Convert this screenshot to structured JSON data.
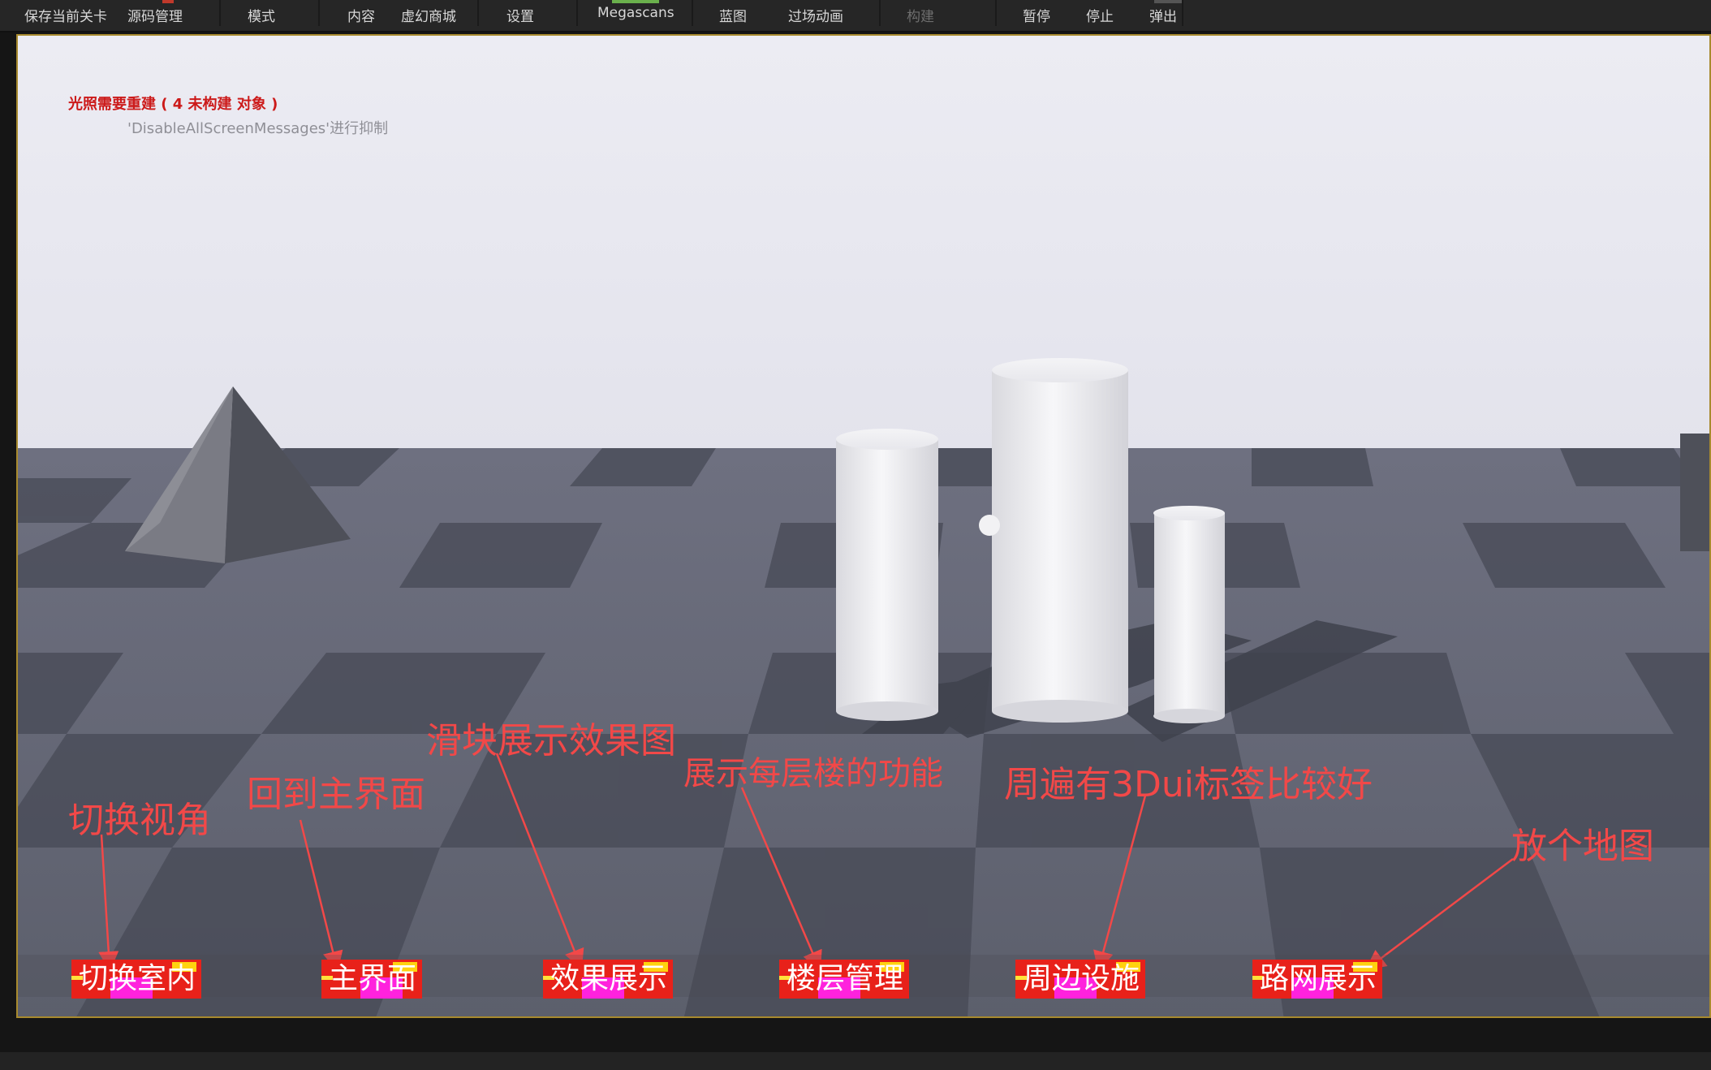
{
  "toolbar": {
    "items": [
      {
        "label": "保存当前关卡",
        "disabled": false
      },
      {
        "label": "源码管理",
        "disabled": false
      },
      {
        "label": "模式",
        "disabled": false
      },
      {
        "label": "内容",
        "disabled": false
      },
      {
        "label": "虚幻商城",
        "disabled": false
      },
      {
        "label": "设置",
        "disabled": false
      },
      {
        "label": "Megascans",
        "disabled": false
      },
      {
        "label": "蓝图",
        "disabled": false
      },
      {
        "label": "过场动画",
        "disabled": false
      },
      {
        "label": "构建",
        "disabled": true
      },
      {
        "label": "暂停",
        "disabled": false
      },
      {
        "label": "停止",
        "disabled": false
      },
      {
        "label": "弹出",
        "disabled": false
      }
    ]
  },
  "viewport": {
    "messages": {
      "lighting_warning": "光照需要重建 ( 4 未构建 对象 )",
      "suppress_hint": "'DisableAllScreenMessages'进行抑制"
    },
    "annotations": [
      {
        "text": "切换视角"
      },
      {
        "text": "回到主界面"
      },
      {
        "text": "滑块展示效果图"
      },
      {
        "text": "展示每层楼的功能"
      },
      {
        "text": "周遍有3Dui标签比较好"
      },
      {
        "text": "放个地图"
      }
    ],
    "buttons": [
      {
        "label": "切换室内"
      },
      {
        "label": "主界面"
      },
      {
        "label": "效果展示"
      },
      {
        "label": "楼层管理"
      },
      {
        "label": "周边设施"
      },
      {
        "label": "路网展示"
      }
    ]
  },
  "colors": {
    "annotation": "#f24848",
    "button_bg": "#e8211a",
    "warning_text": "#cc1a1a",
    "viewport_border": "#a88a2e"
  }
}
